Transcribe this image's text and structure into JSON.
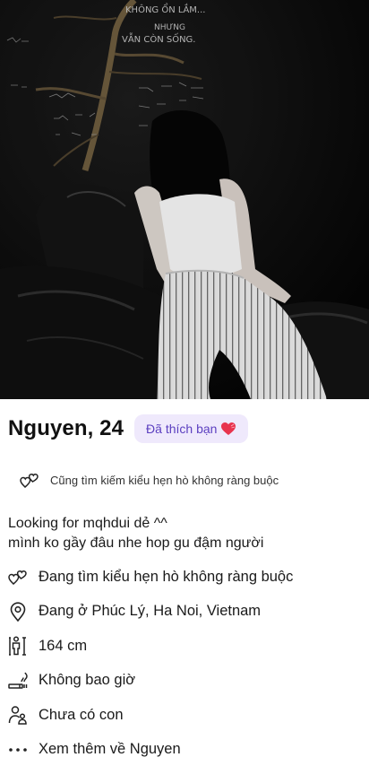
{
  "profile": {
    "name_age": "Nguyen, 24",
    "liked_badge": "Đã thích bạn",
    "goal_line": "Cũng tìm kiếm kiểu hẹn hò không ràng buộc",
    "bio_line1": "Looking for mqhdui dẻ ^^",
    "bio_line2": "mình ko gầy đâu nhe hop gu đậm người"
  },
  "photo": {
    "wall_lines": [
      "KHÔNG ỔN LẮM...",
      "NHƯNG",
      "VẪN CÒN SỐNG."
    ]
  },
  "details": [
    {
      "icon": "hearts-icon",
      "text": "Đang tìm kiểu hẹn hò không ràng buộc"
    },
    {
      "icon": "location-pin-icon",
      "text": "Đang ở Phúc Lý, Ha Noi, Vietnam"
    },
    {
      "icon": "height-icon",
      "text": "164 cm"
    },
    {
      "icon": "smoking-icon",
      "text": "Không bao giờ"
    },
    {
      "icon": "children-icon",
      "text": "Chưa có con"
    },
    {
      "icon": "more-dots-icon",
      "text": "Xem thêm về Nguyen"
    }
  ],
  "colors": {
    "badge_bg": "#efe9fc",
    "badge_text": "#5b3fc0",
    "heart": "#e8344e"
  }
}
